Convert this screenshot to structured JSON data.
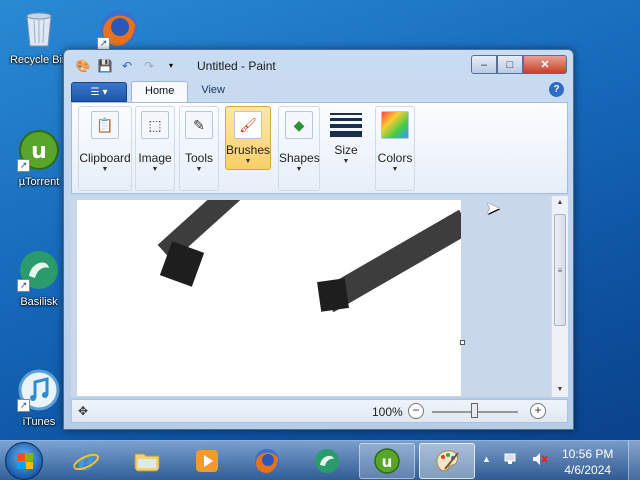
{
  "desktop": {
    "icons": [
      {
        "label": "Recycle Bin",
        "icon": "recycle-bin-icon"
      },
      {
        "label": "",
        "icon": "firefox-icon"
      },
      {
        "label": "µTorrent",
        "icon": "utorrent-icon"
      },
      {
        "label": "Basilisk",
        "icon": "basilisk-icon"
      },
      {
        "label": "iTunes",
        "icon": "itunes-icon"
      }
    ]
  },
  "window": {
    "title": "Untitled - Paint",
    "controls": {
      "minimize": "‒",
      "maximize": "□",
      "close": "✕"
    },
    "tabs": [
      {
        "label": "Home",
        "active": true
      },
      {
        "label": "View",
        "active": false
      }
    ],
    "help": "?",
    "ribbon_groups": [
      {
        "label": "Clipboard",
        "icon": "clipboard-icon",
        "glyph": "📋"
      },
      {
        "label": "Image",
        "icon": "image-select-icon",
        "glyph": "⬚"
      },
      {
        "label": "Tools",
        "icon": "tools-icon",
        "glyph": "✎"
      },
      {
        "label": "Brushes",
        "icon": "brushes-icon",
        "glyph": "🖌",
        "active": true
      },
      {
        "label": "Shapes",
        "icon": "shapes-icon",
        "glyph": "◆"
      },
      {
        "label": "Size",
        "icon": "size-icon"
      },
      {
        "label": "Colors",
        "icon": "colors-icon",
        "glyph": "▦"
      }
    ],
    "statusbar": {
      "zoom_level": "100%",
      "zoom_out": "−",
      "zoom_in": "+",
      "move_icon": "✥",
      "zoom_fraction": 0.5
    }
  },
  "taskbar": {
    "items": [
      {
        "name": "internet-explorer",
        "icon": "internet-explorer-icon",
        "state": "idle"
      },
      {
        "name": "file-explorer",
        "icon": "folder-icon",
        "state": "idle"
      },
      {
        "name": "media-player",
        "icon": "media-player-icon",
        "state": "idle"
      },
      {
        "name": "firefox",
        "icon": "firefox-icon",
        "state": "idle"
      },
      {
        "name": "basilisk",
        "icon": "basilisk-icon",
        "state": "idle"
      },
      {
        "name": "utorrent",
        "icon": "utorrent-icon",
        "state": "running"
      },
      {
        "name": "paint",
        "icon": "paint-icon",
        "state": "active"
      }
    ],
    "tray": {
      "show_hidden": "▲",
      "network": "network-icon",
      "volume": "volume-muted-icon"
    },
    "clock": {
      "time": "10:56 PM",
      "date": "4/6/2024"
    }
  },
  "colors": {
    "accent": "#1c55a8",
    "brush_active": "#f8cf68",
    "close_button": "#c7402a",
    "stroke": "#3d3d3d"
  }
}
